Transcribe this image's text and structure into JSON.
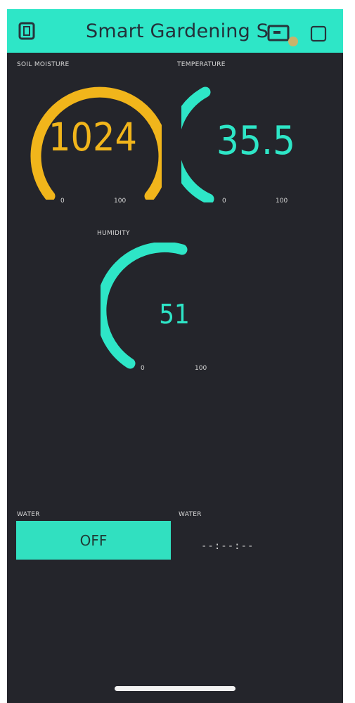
{
  "app": {
    "title": "Smart Gardening Sys",
    "accent_color": "#2ee6c7"
  },
  "header_icons": {
    "left": "exit-icon",
    "right_1": "device-icon",
    "right_2": "square-icon"
  },
  "gauges": {
    "soil": {
      "label": "SOIL MOISTURE",
      "value": "1024",
      "min": "0",
      "max": "100",
      "color": "#f1b51b"
    },
    "temperature": {
      "label": "TEMPERATURE",
      "value": "35.5",
      "min": "0",
      "max": "100",
      "color": "#2ee6c7"
    },
    "humidity": {
      "label": "HUMIDITY",
      "value": "51",
      "min": "0",
      "max": "100",
      "color": "#2ee6c7"
    }
  },
  "controls": {
    "water_button_label": "WATER",
    "water_button_text": "OFF",
    "water_timer_label": "WATER",
    "water_timer_value": "--:--:--"
  }
}
